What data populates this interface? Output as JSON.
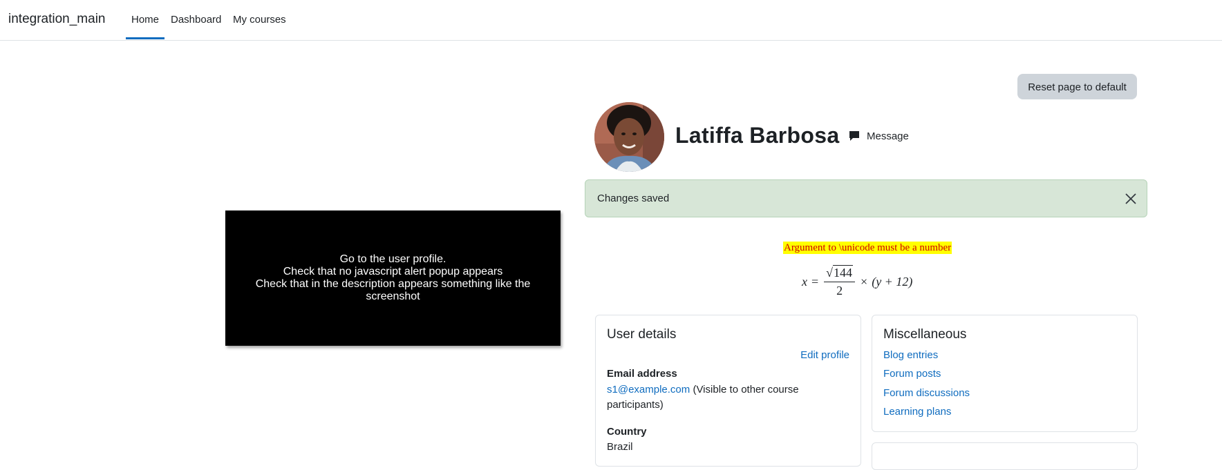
{
  "navbar": {
    "brand": "integration_main",
    "items": [
      {
        "label": "Home",
        "active": true
      },
      {
        "label": "Dashboard",
        "active": false
      },
      {
        "label": "My courses",
        "active": false
      }
    ]
  },
  "header": {
    "reset_label": "Reset page to default",
    "user_name": "Latiffa Barbosa",
    "message_label": "Message"
  },
  "alert": {
    "text": "Changes saved"
  },
  "video": {
    "lines": [
      "Go to the user profile.",
      "Check that no javascript alert popup appears",
      "Check that in the description  appears something like the screenshot"
    ]
  },
  "description": {
    "math_error": "Argument to \\unicode must be a number",
    "formula": {
      "lhs": "x",
      "eq": "=",
      "sqrt_arg": "144",
      "denominator": "2",
      "times": "×",
      "paren": "(y + 12)"
    }
  },
  "user_details": {
    "title": "User details",
    "edit_label": "Edit profile",
    "email_label": "Email address",
    "email_value": "s1@example.com",
    "email_note": "(Visible to other course participants)",
    "country_label": "Country",
    "country_value": "Brazil"
  },
  "misc": {
    "title": "Miscellaneous",
    "links": [
      "Blog entries",
      "Forum posts",
      "Forum discussions",
      "Learning plans"
    ]
  },
  "colors": {
    "accent": "#0f6cbf",
    "success_bg": "#d7e6d7",
    "error_text": "#d00000",
    "error_bg": "#ffff00"
  }
}
